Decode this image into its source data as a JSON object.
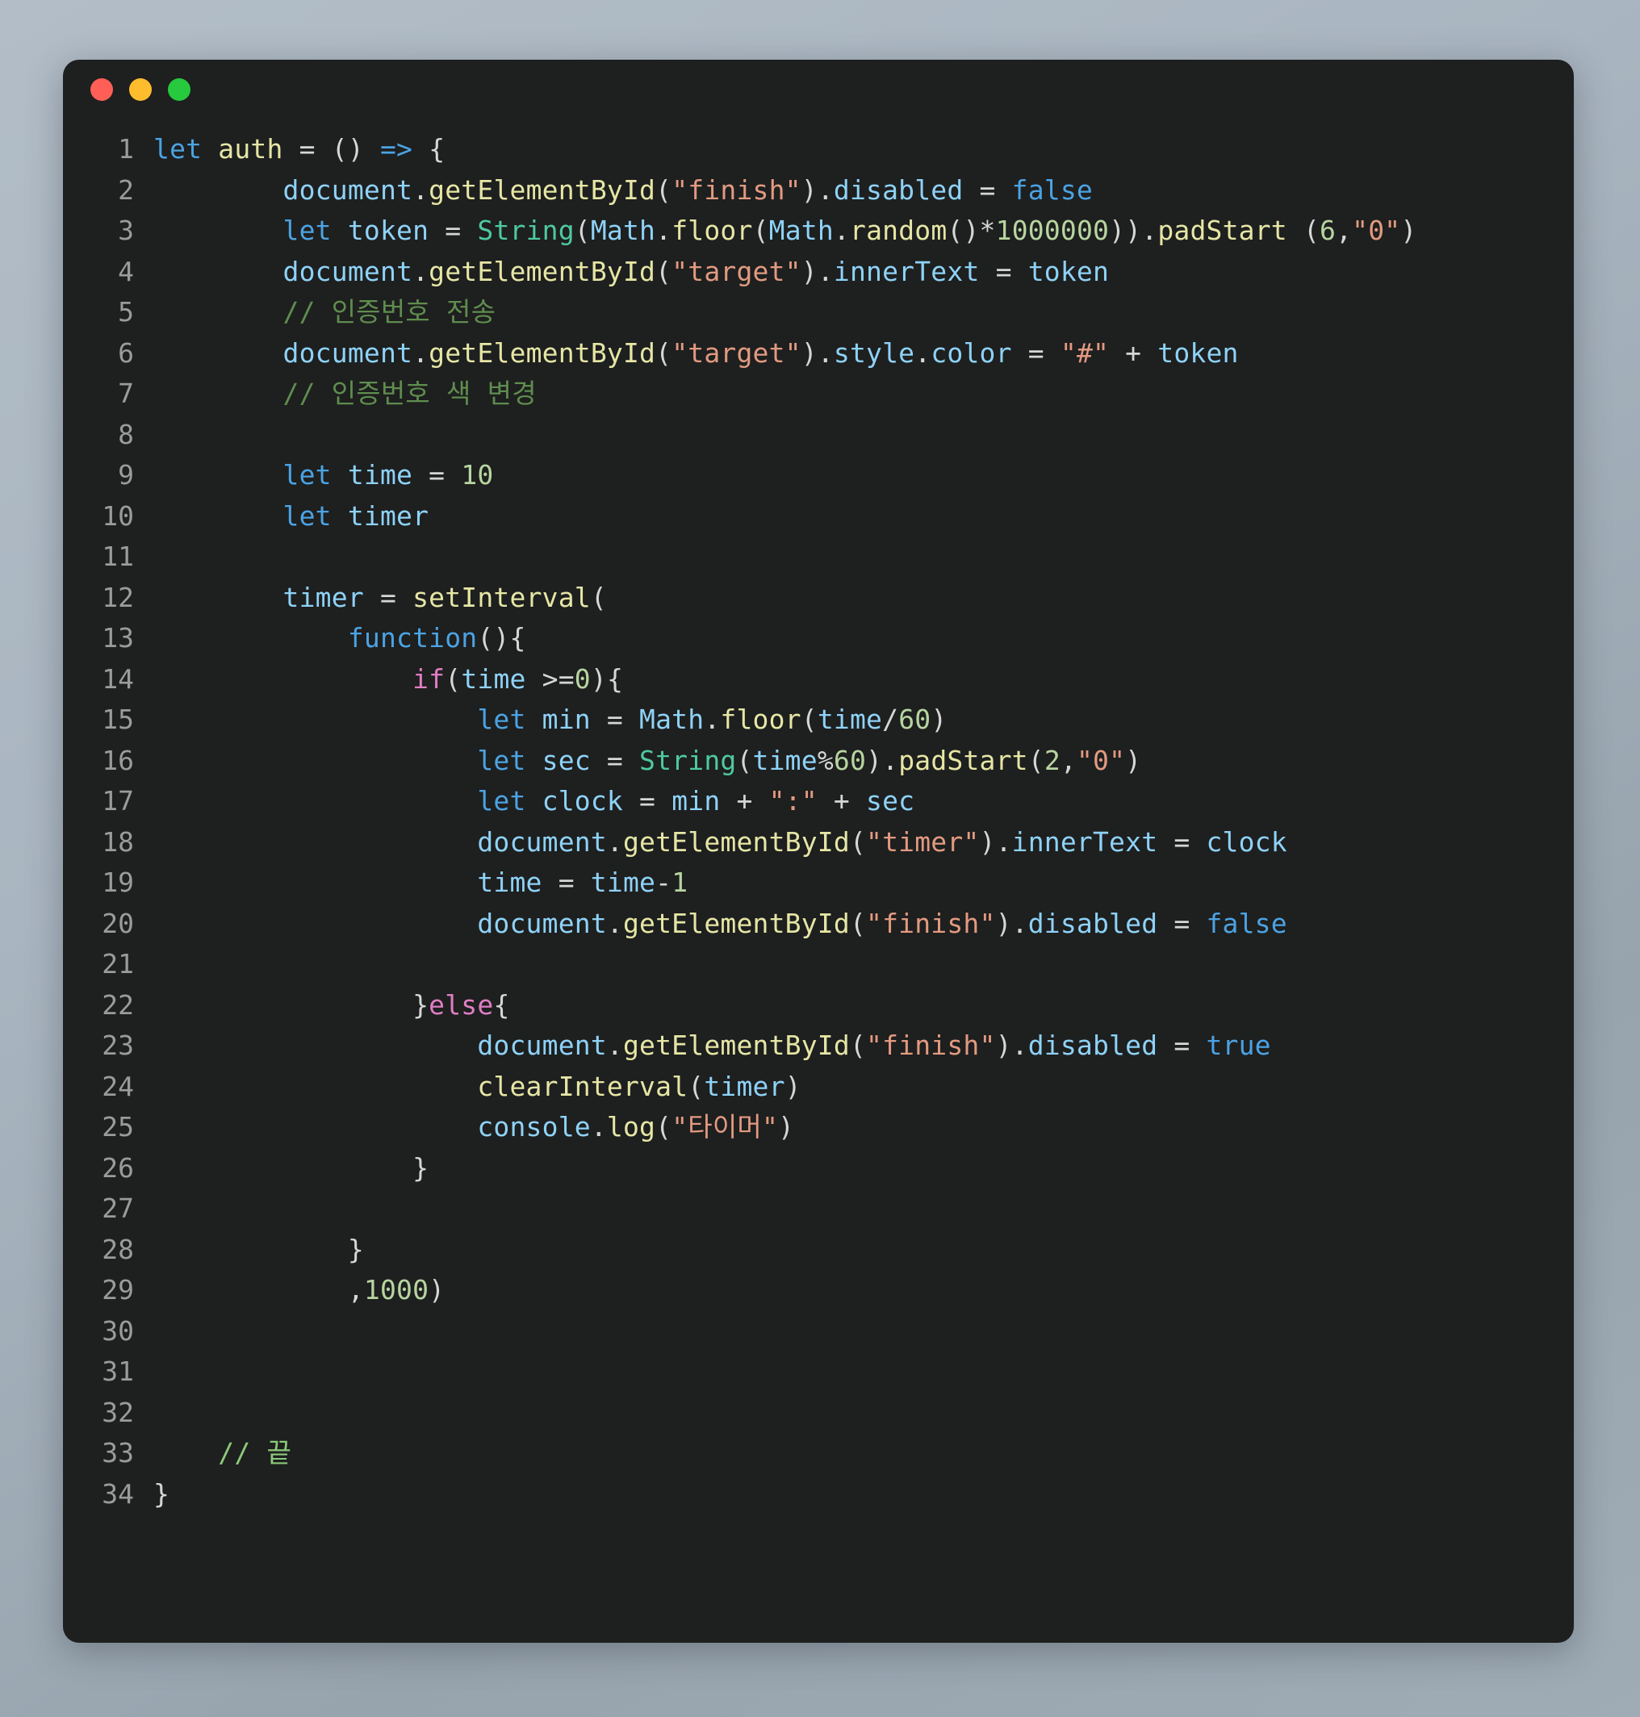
{
  "window": {
    "title": "code-snippet",
    "traffic_lights": [
      {
        "name": "close-button",
        "label": "Close",
        "color": "#ff5f56"
      },
      {
        "name": "minimize-button",
        "label": "Minimize",
        "color": "#ffbd2e"
      },
      {
        "name": "maximize-button",
        "label": "Maximize",
        "color": "#27c93f"
      }
    ]
  },
  "editor": {
    "language": "javascript",
    "background": "#1e1f1f",
    "line_number_color": "#9b9b9b",
    "total_lines": 34,
    "line_numbers": [
      "1",
      "2",
      "3",
      "4",
      "5",
      "6",
      "7",
      "8",
      "9",
      "10",
      "11",
      "12",
      "13",
      "14",
      "15",
      "16",
      "17",
      "18",
      "19",
      "20",
      "21",
      "22",
      "23",
      "24",
      "25",
      "26",
      "27",
      "28",
      "29",
      "30",
      "31",
      "32",
      "33",
      "34"
    ],
    "lines": [
      {
        "n": "1",
        "text": "let auth = () => {"
      },
      {
        "n": "2",
        "text": "        document.getElementById(\"finish\").disabled = false"
      },
      {
        "n": "3",
        "text": "        let token = String(Math.floor(Math.random()*1000000)).padStart (6,\"0\")"
      },
      {
        "n": "4",
        "text": "        document.getElementById(\"target\").innerText = token"
      },
      {
        "n": "5",
        "text": "        // 인증번호 전송"
      },
      {
        "n": "6",
        "text": "        document.getElementById(\"target\").style.color = \"#\" + token"
      },
      {
        "n": "7",
        "text": "        // 인증번호 색 변경"
      },
      {
        "n": "8",
        "text": ""
      },
      {
        "n": "9",
        "text": "        let time = 10"
      },
      {
        "n": "10",
        "text": "        let timer"
      },
      {
        "n": "11",
        "text": ""
      },
      {
        "n": "12",
        "text": "        timer = setInterval("
      },
      {
        "n": "13",
        "text": "            function(){"
      },
      {
        "n": "14",
        "text": "                if(time >=0){"
      },
      {
        "n": "15",
        "text": "                    let min = Math.floor(time/60)"
      },
      {
        "n": "16",
        "text": "                    let sec = String(time%60).padStart(2,\"0\")"
      },
      {
        "n": "17",
        "text": "                    let clock = min + \":\" + sec"
      },
      {
        "n": "18",
        "text": "                    document.getElementById(\"timer\").innerText = clock"
      },
      {
        "n": "19",
        "text": "                    time = time-1"
      },
      {
        "n": "20",
        "text": "                    document.getElementById(\"finish\").disabled = false"
      },
      {
        "n": "21",
        "text": ""
      },
      {
        "n": "22",
        "text": "                }else{"
      },
      {
        "n": "23",
        "text": "                    document.getElementById(\"finish\").disabled = true"
      },
      {
        "n": "24",
        "text": "                    clearInterval(timer)"
      },
      {
        "n": "25",
        "text": "                    console.log(\"타이머\")"
      },
      {
        "n": "26",
        "text": "                }"
      },
      {
        "n": "27",
        "text": ""
      },
      {
        "n": "28",
        "text": "            }"
      },
      {
        "n": "29",
        "text": "            ,1000)"
      },
      {
        "n": "30",
        "text": ""
      },
      {
        "n": "31",
        "text": ""
      },
      {
        "n": "32",
        "text": ""
      },
      {
        "n": "33",
        "text": "    // 끝"
      },
      {
        "n": "34",
        "text": "}"
      }
    ],
    "tokens": [
      [
        {
          "t": "let ",
          "c": "t-kw"
        },
        {
          "t": "auth",
          "c": "t-fn"
        },
        {
          "t": " = ",
          "c": "t-punc"
        },
        {
          "t": "()",
          "c": "t-punc"
        },
        {
          "t": " ",
          "c": "t-punc"
        },
        {
          "t": "=>",
          "c": "t-kw"
        },
        {
          "t": " {",
          "c": "t-punc"
        }
      ],
      [
        {
          "t": "        ",
          "c": "t-plain"
        },
        {
          "t": "document",
          "c": "t-var"
        },
        {
          "t": ".",
          "c": "t-punc"
        },
        {
          "t": "getElementById",
          "c": "t-fn"
        },
        {
          "t": "(",
          "c": "t-punc"
        },
        {
          "t": "\"finish\"",
          "c": "t-str"
        },
        {
          "t": ")",
          "c": "t-punc"
        },
        {
          "t": ".",
          "c": "t-punc"
        },
        {
          "t": "disabled",
          "c": "t-var"
        },
        {
          "t": " = ",
          "c": "t-punc"
        },
        {
          "t": "false",
          "c": "t-kw"
        }
      ],
      [
        {
          "t": "        ",
          "c": "t-plain"
        },
        {
          "t": "let ",
          "c": "t-kw"
        },
        {
          "t": "token",
          "c": "t-var"
        },
        {
          "t": " = ",
          "c": "t-punc"
        },
        {
          "t": "String",
          "c": "t-cls"
        },
        {
          "t": "(",
          "c": "t-punc"
        },
        {
          "t": "Math",
          "c": "t-var"
        },
        {
          "t": ".",
          "c": "t-punc"
        },
        {
          "t": "floor",
          "c": "t-fn"
        },
        {
          "t": "(",
          "c": "t-punc"
        },
        {
          "t": "Math",
          "c": "t-var"
        },
        {
          "t": ".",
          "c": "t-punc"
        },
        {
          "t": "random",
          "c": "t-fn"
        },
        {
          "t": "()",
          "c": "t-punc"
        },
        {
          "t": "*",
          "c": "t-punc"
        },
        {
          "t": "1000000",
          "c": "t-num"
        },
        {
          "t": "))",
          "c": "t-punc"
        },
        {
          "t": ".",
          "c": "t-punc"
        },
        {
          "t": "padStart",
          "c": "t-fn"
        },
        {
          "t": " (",
          "c": "t-punc"
        },
        {
          "t": "6",
          "c": "t-num"
        },
        {
          "t": ",",
          "c": "t-punc"
        },
        {
          "t": "\"0\"",
          "c": "t-str"
        },
        {
          "t": ")",
          "c": "t-punc"
        }
      ],
      [
        {
          "t": "        ",
          "c": "t-plain"
        },
        {
          "t": "document",
          "c": "t-var"
        },
        {
          "t": ".",
          "c": "t-punc"
        },
        {
          "t": "getElementById",
          "c": "t-fn"
        },
        {
          "t": "(",
          "c": "t-punc"
        },
        {
          "t": "\"target\"",
          "c": "t-str"
        },
        {
          "t": ")",
          "c": "t-punc"
        },
        {
          "t": ".",
          "c": "t-punc"
        },
        {
          "t": "innerText",
          "c": "t-var"
        },
        {
          "t": " = ",
          "c": "t-punc"
        },
        {
          "t": "token",
          "c": "t-var"
        }
      ],
      [
        {
          "t": "        ",
          "c": "t-plain"
        },
        {
          "t": "// 인증번호 전송",
          "c": "t-com"
        }
      ],
      [
        {
          "t": "        ",
          "c": "t-plain"
        },
        {
          "t": "document",
          "c": "t-var"
        },
        {
          "t": ".",
          "c": "t-punc"
        },
        {
          "t": "getElementById",
          "c": "t-fn"
        },
        {
          "t": "(",
          "c": "t-punc"
        },
        {
          "t": "\"target\"",
          "c": "t-str"
        },
        {
          "t": ")",
          "c": "t-punc"
        },
        {
          "t": ".",
          "c": "t-punc"
        },
        {
          "t": "style",
          "c": "t-var"
        },
        {
          "t": ".",
          "c": "t-punc"
        },
        {
          "t": "color",
          "c": "t-var"
        },
        {
          "t": " = ",
          "c": "t-punc"
        },
        {
          "t": "\"#\"",
          "c": "t-str"
        },
        {
          "t": " + ",
          "c": "t-punc"
        },
        {
          "t": "token",
          "c": "t-var"
        }
      ],
      [
        {
          "t": "        ",
          "c": "t-plain"
        },
        {
          "t": "// 인증번호 색 변경",
          "c": "t-com"
        }
      ],
      [],
      [
        {
          "t": "        ",
          "c": "t-plain"
        },
        {
          "t": "let ",
          "c": "t-kw"
        },
        {
          "t": "time",
          "c": "t-var"
        },
        {
          "t": " = ",
          "c": "t-punc"
        },
        {
          "t": "10",
          "c": "t-num"
        }
      ],
      [
        {
          "t": "        ",
          "c": "t-plain"
        },
        {
          "t": "let ",
          "c": "t-kw"
        },
        {
          "t": "timer",
          "c": "t-var"
        }
      ],
      [],
      [
        {
          "t": "        ",
          "c": "t-plain"
        },
        {
          "t": "timer",
          "c": "t-var"
        },
        {
          "t": " = ",
          "c": "t-punc"
        },
        {
          "t": "setInterval",
          "c": "t-fn"
        },
        {
          "t": "(",
          "c": "t-punc"
        }
      ],
      [
        {
          "t": "            ",
          "c": "t-plain"
        },
        {
          "t": "function",
          "c": "t-kw"
        },
        {
          "t": "(){",
          "c": "t-punc"
        }
      ],
      [
        {
          "t": "                ",
          "c": "t-plain"
        },
        {
          "t": "if",
          "c": "t-kw2"
        },
        {
          "t": "(",
          "c": "t-punc"
        },
        {
          "t": "time",
          "c": "t-var"
        },
        {
          "t": " >=",
          "c": "t-punc"
        },
        {
          "t": "0",
          "c": "t-num"
        },
        {
          "t": "){",
          "c": "t-punc"
        }
      ],
      [
        {
          "t": "                    ",
          "c": "t-plain"
        },
        {
          "t": "let ",
          "c": "t-kw"
        },
        {
          "t": "min",
          "c": "t-var"
        },
        {
          "t": " = ",
          "c": "t-punc"
        },
        {
          "t": "Math",
          "c": "t-var"
        },
        {
          "t": ".",
          "c": "t-punc"
        },
        {
          "t": "floor",
          "c": "t-fn"
        },
        {
          "t": "(",
          "c": "t-punc"
        },
        {
          "t": "time",
          "c": "t-var"
        },
        {
          "t": "/",
          "c": "t-punc"
        },
        {
          "t": "60",
          "c": "t-num"
        },
        {
          "t": ")",
          "c": "t-punc"
        }
      ],
      [
        {
          "t": "                    ",
          "c": "t-plain"
        },
        {
          "t": "let ",
          "c": "t-kw"
        },
        {
          "t": "sec",
          "c": "t-var"
        },
        {
          "t": " = ",
          "c": "t-punc"
        },
        {
          "t": "String",
          "c": "t-cls"
        },
        {
          "t": "(",
          "c": "t-punc"
        },
        {
          "t": "time",
          "c": "t-var"
        },
        {
          "t": "%",
          "c": "t-punc"
        },
        {
          "t": "60",
          "c": "t-num"
        },
        {
          "t": ")",
          "c": "t-punc"
        },
        {
          "t": ".",
          "c": "t-punc"
        },
        {
          "t": "padStart",
          "c": "t-fn"
        },
        {
          "t": "(",
          "c": "t-punc"
        },
        {
          "t": "2",
          "c": "t-num"
        },
        {
          "t": ",",
          "c": "t-punc"
        },
        {
          "t": "\"0\"",
          "c": "t-str"
        },
        {
          "t": ")",
          "c": "t-punc"
        }
      ],
      [
        {
          "t": "                    ",
          "c": "t-plain"
        },
        {
          "t": "let ",
          "c": "t-kw"
        },
        {
          "t": "clock",
          "c": "t-var"
        },
        {
          "t": " = ",
          "c": "t-punc"
        },
        {
          "t": "min",
          "c": "t-var"
        },
        {
          "t": " + ",
          "c": "t-punc"
        },
        {
          "t": "\":\"",
          "c": "t-str"
        },
        {
          "t": " + ",
          "c": "t-punc"
        },
        {
          "t": "sec",
          "c": "t-var"
        }
      ],
      [
        {
          "t": "                    ",
          "c": "t-plain"
        },
        {
          "t": "document",
          "c": "t-var"
        },
        {
          "t": ".",
          "c": "t-punc"
        },
        {
          "t": "getElementById",
          "c": "t-fn"
        },
        {
          "t": "(",
          "c": "t-punc"
        },
        {
          "t": "\"timer\"",
          "c": "t-str"
        },
        {
          "t": ")",
          "c": "t-punc"
        },
        {
          "t": ".",
          "c": "t-punc"
        },
        {
          "t": "innerText",
          "c": "t-var"
        },
        {
          "t": " = ",
          "c": "t-punc"
        },
        {
          "t": "clock",
          "c": "t-var"
        }
      ],
      [
        {
          "t": "                    ",
          "c": "t-plain"
        },
        {
          "t": "time",
          "c": "t-var"
        },
        {
          "t": " = ",
          "c": "t-punc"
        },
        {
          "t": "time",
          "c": "t-var"
        },
        {
          "t": "-",
          "c": "t-punc"
        },
        {
          "t": "1",
          "c": "t-num"
        }
      ],
      [
        {
          "t": "                    ",
          "c": "t-plain"
        },
        {
          "t": "document",
          "c": "t-var"
        },
        {
          "t": ".",
          "c": "t-punc"
        },
        {
          "t": "getElementById",
          "c": "t-fn"
        },
        {
          "t": "(",
          "c": "t-punc"
        },
        {
          "t": "\"finish\"",
          "c": "t-str"
        },
        {
          "t": ")",
          "c": "t-punc"
        },
        {
          "t": ".",
          "c": "t-punc"
        },
        {
          "t": "disabled",
          "c": "t-var"
        },
        {
          "t": " = ",
          "c": "t-punc"
        },
        {
          "t": "false",
          "c": "t-kw"
        }
      ],
      [],
      [
        {
          "t": "                ",
          "c": "t-plain"
        },
        {
          "t": "}",
          "c": "t-punc"
        },
        {
          "t": "else",
          "c": "t-kw2"
        },
        {
          "t": "{",
          "c": "t-punc"
        }
      ],
      [
        {
          "t": "                    ",
          "c": "t-plain"
        },
        {
          "t": "document",
          "c": "t-var"
        },
        {
          "t": ".",
          "c": "t-punc"
        },
        {
          "t": "getElementById",
          "c": "t-fn"
        },
        {
          "t": "(",
          "c": "t-punc"
        },
        {
          "t": "\"finish\"",
          "c": "t-str"
        },
        {
          "t": ")",
          "c": "t-punc"
        },
        {
          "t": ".",
          "c": "t-punc"
        },
        {
          "t": "disabled",
          "c": "t-var"
        },
        {
          "t": " = ",
          "c": "t-punc"
        },
        {
          "t": "true",
          "c": "t-kw"
        }
      ],
      [
        {
          "t": "                    ",
          "c": "t-plain"
        },
        {
          "t": "clearInterval",
          "c": "t-fn"
        },
        {
          "t": "(",
          "c": "t-punc"
        },
        {
          "t": "timer",
          "c": "t-var"
        },
        {
          "t": ")",
          "c": "t-punc"
        }
      ],
      [
        {
          "t": "                    ",
          "c": "t-plain"
        },
        {
          "t": "console",
          "c": "t-var"
        },
        {
          "t": ".",
          "c": "t-punc"
        },
        {
          "t": "log",
          "c": "t-fn"
        },
        {
          "t": "(",
          "c": "t-punc"
        },
        {
          "t": "\"타이머\"",
          "c": "t-str"
        },
        {
          "t": ")",
          "c": "t-punc"
        }
      ],
      [
        {
          "t": "                ",
          "c": "t-plain"
        },
        {
          "t": "}",
          "c": "t-punc"
        }
      ],
      [],
      [
        {
          "t": "            ",
          "c": "t-plain"
        },
        {
          "t": "}",
          "c": "t-punc"
        }
      ],
      [
        {
          "t": "            ",
          "c": "t-plain"
        },
        {
          "t": ",",
          "c": "t-punc"
        },
        {
          "t": "1000",
          "c": "t-num"
        },
        {
          "t": ")",
          "c": "t-punc"
        }
      ],
      [],
      [],
      [],
      [
        {
          "t": "    ",
          "c": "t-plain"
        },
        {
          "t": "// 끝",
          "c": "t-com2"
        }
      ],
      [
        {
          "t": "}",
          "c": "t-punc"
        }
      ]
    ]
  }
}
